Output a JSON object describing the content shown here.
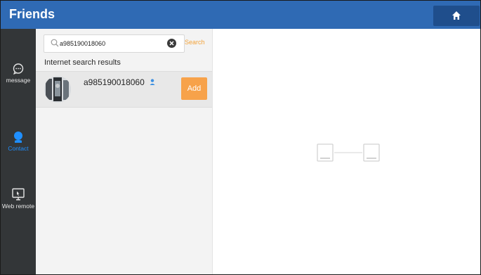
{
  "header": {
    "title": "Friends",
    "home_icon": "home-icon",
    "accent_color": "#2f6ab4"
  },
  "sidebar": {
    "items": [
      {
        "label": "message",
        "icon": "chat-bubble-icon",
        "active": false
      },
      {
        "label": "Contact",
        "icon": "contact-icon",
        "active": true
      },
      {
        "label": "Web remote",
        "icon": "web-remote-icon",
        "active": false
      }
    ],
    "active_color": "#1f8fff"
  },
  "search": {
    "value": "a985190018060",
    "search_label": "Search",
    "search_color": "#f3a33a"
  },
  "results": {
    "section_label": "Internet search results",
    "items": [
      {
        "username": "a985190018060",
        "add_label": "Add"
      }
    ],
    "add_color": "#f7a24a"
  },
  "detail": {
    "empty_icon": "device-link-placeholder-icon"
  }
}
